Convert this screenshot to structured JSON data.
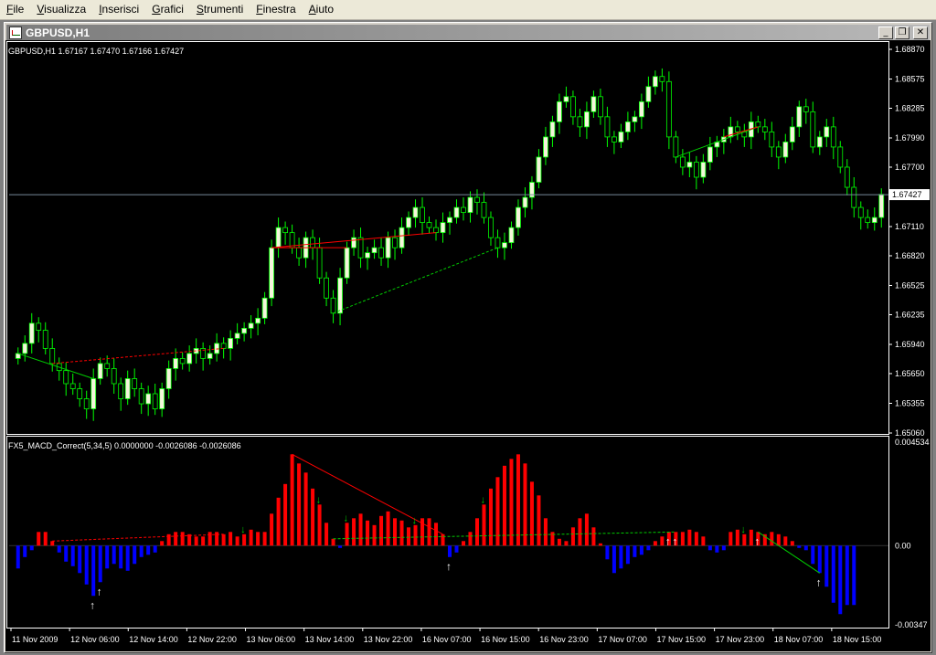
{
  "menu": [
    "File",
    "Visualizza",
    "Inserisci",
    "Grafici",
    "Strumenti",
    "Finestra",
    "Aiuto"
  ],
  "window": {
    "title": "GBPUSD,H1",
    "minimize_icon": "minimize-icon",
    "restore_icon": "restore-icon",
    "close_icon": "close-icon"
  },
  "main_chart": {
    "header": "GBPUSD,H1  1.67167 1.67470 1.67166 1.67427",
    "price_labels": [
      "1.68870",
      "1.68575",
      "1.68285",
      "1.67990",
      "1.67700",
      "1.67427",
      "1.67110",
      "1.66820",
      "1.66525",
      "1.66235",
      "1.65940",
      "1.65650",
      "1.65355",
      "1.65060"
    ],
    "current_price": "1.67427"
  },
  "indicator": {
    "header": "FX5_MACD_Correct(5,34,5) 0.0000000 -0.0026086 -0.0026086",
    "labels": [
      "0.004534",
      "0.00",
      "-0.00347"
    ]
  },
  "time_labels": [
    "11 Nov 2009",
    "12 Nov 06:00",
    "12 Nov 14:00",
    "12 Nov 22:00",
    "13 Nov 06:00",
    "13 Nov 14:00",
    "13 Nov 22:00",
    "16 Nov 07:00",
    "16 Nov 15:00",
    "16 Nov 23:00",
    "17 Nov 07:00",
    "17 Nov 15:00",
    "17 Nov 23:00",
    "18 Nov 07:00",
    "18 Nov 15:00"
  ],
  "colors": {
    "bull_candle": "#f5f5dc",
    "bear_candle": "#000000",
    "wick": "#00ff00",
    "hist_pos": "#ff0000",
    "hist_neg": "#0000ff",
    "divergence": "#ff0000",
    "convergence": "#00cc00",
    "bid_line": "#778899"
  },
  "chart_data": {
    "type": "candlestick",
    "close": [
      1.6585,
      1.6595,
      1.6615,
      1.6608,
      1.659,
      1.6575,
      1.6568,
      1.6555,
      1.655,
      1.654,
      1.653,
      1.656,
      1.6575,
      1.657,
      1.6555,
      1.654,
      1.656,
      1.655,
      1.6535,
      1.6545,
      1.653,
      1.655,
      1.657,
      1.658,
      1.6575,
      1.6585,
      1.659,
      1.658,
      1.6585,
      1.6595,
      1.659,
      1.66,
      1.6605,
      1.661,
      1.6615,
      1.662,
      1.664,
      1.669,
      1.671,
      1.6705,
      1.669,
      1.668,
      1.67,
      1.669,
      1.666,
      1.664,
      1.6625,
      1.666,
      1.669,
      1.67,
      1.668,
      1.6685,
      1.669,
      1.668,
      1.67,
      1.669,
      1.671,
      1.672,
      1.673,
      1.6715,
      1.671,
      1.6705,
      1.6715,
      1.672,
      1.673,
      1.6725,
      1.674,
      1.6735,
      1.672,
      1.67,
      1.669,
      1.6695,
      1.671,
      1.673,
      1.674,
      1.6755,
      1.678,
      1.68,
      1.6815,
      1.6835,
      1.684,
      1.682,
      1.681,
      1.6825,
      1.684,
      1.682,
      1.68,
      1.6795,
      1.6805,
      1.6815,
      1.682,
      1.6835,
      1.685,
      1.686,
      1.6855,
      1.68,
      1.678,
      1.677,
      1.6775,
      1.676,
      1.6775,
      1.679,
      1.6795,
      1.68,
      1.681,
      1.6805,
      1.68,
      1.6815,
      1.681,
      1.6805,
      1.679,
      1.678,
      1.6795,
      1.681,
      1.683,
      1.6825,
      1.679,
      1.68,
      1.681,
      1.679,
      1.677,
      1.675,
      1.673,
      1.672,
      1.6715,
      1.672,
      1.6743
    ],
    "macd_histogram": [
      -0.001,
      -0.0005,
      -0.0002,
      0.0006,
      0.0006,
      0.0002,
      -0.0003,
      -0.0007,
      -0.0009,
      -0.0012,
      -0.0017,
      -0.0022,
      -0.0016,
      -0.001,
      -0.0008,
      -0.001,
      -0.0011,
      -0.0008,
      -0.0005,
      -0.0004,
      -0.0003,
      0.0002,
      0.0005,
      0.0006,
      0.0006,
      0.0005,
      0.0004,
      0.0004,
      0.0006,
      0.0006,
      0.0005,
      0.0006,
      0.0004,
      0.0005,
      0.0007,
      0.0006,
      0.0006,
      0.0014,
      0.0021,
      0.0027,
      0.004,
      0.0036,
      0.0032,
      0.0025,
      0.0018,
      0.001,
      0.0003,
      -0.0001,
      0.001,
      0.0012,
      0.0014,
      0.0011,
      0.0009,
      0.0013,
      0.0015,
      0.0012,
      0.0011,
      0.0008,
      0.0009,
      0.0012,
      0.0012,
      0.001,
      0.0005,
      -0.0005,
      -0.0003,
      0.0002,
      0.0006,
      0.0012,
      0.0018,
      0.0025,
      0.003,
      0.0035,
      0.0038,
      0.004,
      0.0036,
      0.0028,
      0.0022,
      0.0012,
      0.0006,
      0.0003,
      0.0002,
      0.0008,
      0.0012,
      0.0014,
      0.0008,
      0.0001,
      -0.0006,
      -0.0012,
      -0.001,
      -0.0008,
      -0.0005,
      -0.0004,
      -0.0002,
      0.0002,
      0.0004,
      0.0006,
      0.0006,
      0.0006,
      0.0007,
      0.0006,
      0.0004,
      -0.0002,
      -0.0003,
      -0.0002,
      0.0006,
      0.0007,
      0.0005,
      0.0007,
      0.0006,
      0.0005,
      0.0006,
      0.0005,
      0.0004,
      0.0002,
      -0.0001,
      -0.0002,
      -0.0008,
      -0.0012,
      -0.0018,
      -0.0025,
      -0.003,
      -0.0026,
      -0.0026
    ],
    "price_range": [
      1.6506,
      1.6887
    ],
    "indicator_range": [
      -0.00347,
      0.004534
    ]
  }
}
